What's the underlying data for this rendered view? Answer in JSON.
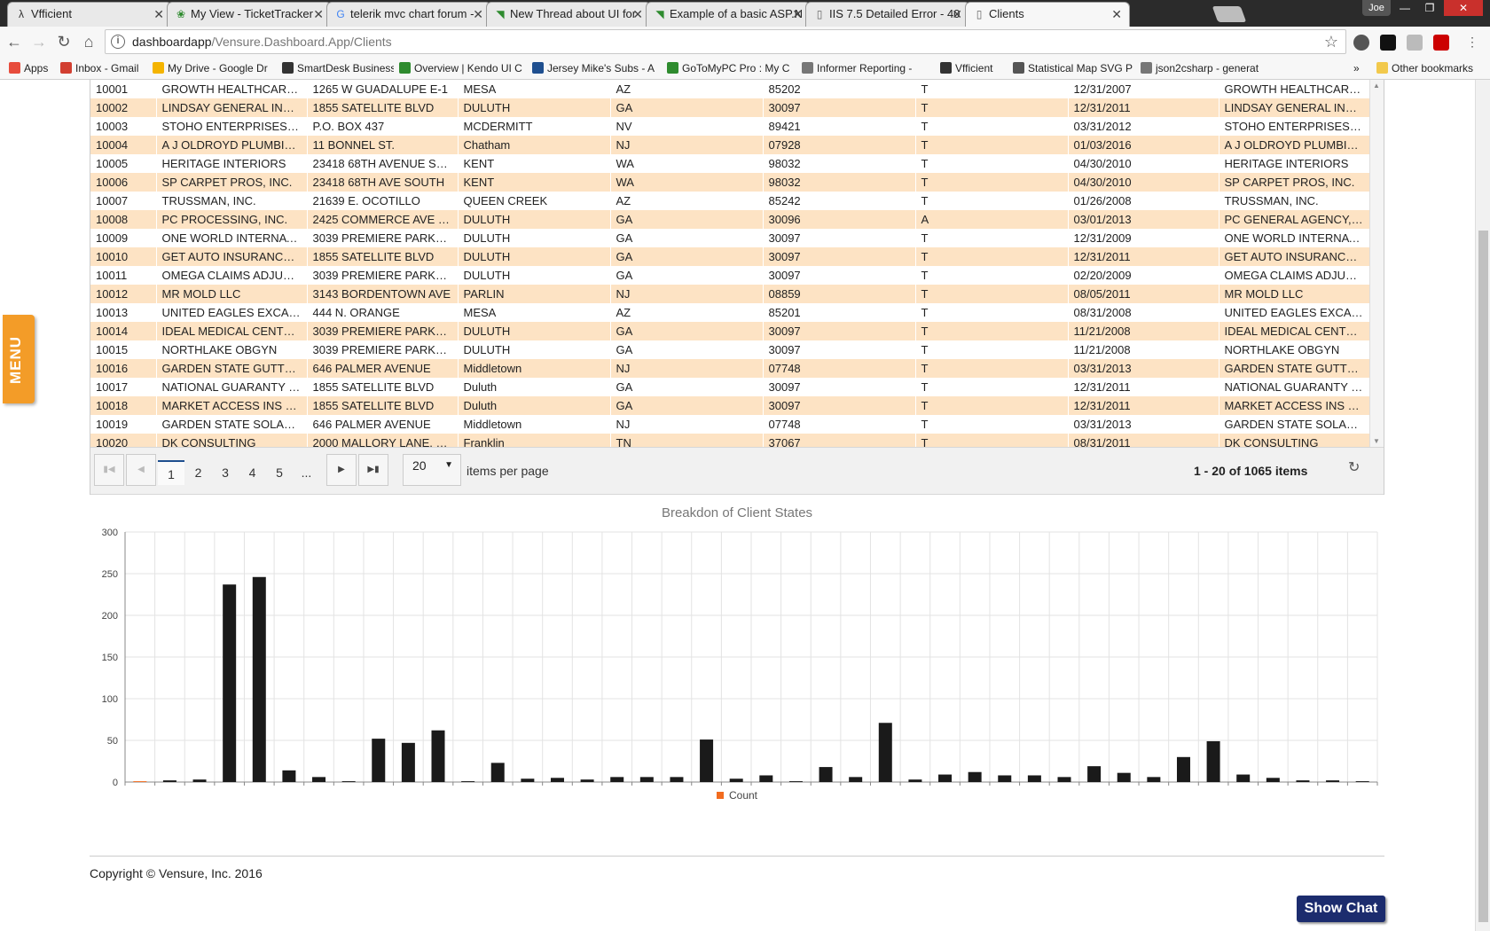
{
  "browser": {
    "tabs": [
      {
        "title": "Vfficient",
        "icon": "vfficient-icon"
      },
      {
        "title": "My View - TicketTracker",
        "icon": "tickettracker-icon"
      },
      {
        "title": "telerik mvc chart forum -",
        "icon": "google-icon"
      },
      {
        "title": "New Thread about UI for",
        "icon": "telerik-icon"
      },
      {
        "title": "Example of a basic ASP.N",
        "icon": "telerik-icon"
      },
      {
        "title": "IIS 7.5 Detailed Error - 40",
        "icon": "page-icon"
      },
      {
        "title": "Clients",
        "icon": "page-icon"
      }
    ],
    "profile_name": "Joe",
    "url_host": "dashboardapp",
    "url_path": "/Vensure.Dashboard.App/Clients",
    "bookmarks": [
      "Apps",
      "Inbox - Gmail",
      "My Drive - Google Dr",
      "SmartDesk Business C",
      "Overview | Kendo UI C",
      "Jersey Mike's Subs - A",
      "GoToMyPC Pro : My C",
      "Informer Reporting -",
      "Vfficient",
      "Statistical Map SVG P",
      "json2csharp - generat"
    ],
    "other_bookmarks": "Other bookmarks"
  },
  "side_menu_label": "MENU",
  "grid": {
    "rows": [
      [
        "10001",
        "GROWTH HEALTHCARE…",
        "1265 W GUADALUPE E-1",
        "MESA",
        "AZ",
        "85202",
        "T",
        "12/31/2007",
        "GROWTH HEALTHCARE…"
      ],
      [
        "10002",
        "LINDSAY GENERAL INS…",
        "1855 SATELLITE BLVD",
        "DULUTH",
        "GA",
        "30097",
        "T",
        "12/31/2011",
        "LINDSAY GENERAL INS…"
      ],
      [
        "10003",
        "STOHO ENTERPRISES,…",
        "P.O. BOX 437",
        "MCDERMITT",
        "NV",
        "89421",
        "T",
        "03/31/2012",
        "STOHO ENTERPRISES, …"
      ],
      [
        "10004",
        "A J OLDROYD PLUMBIN…",
        "11 BONNEL ST.",
        "Chatham",
        "NJ",
        "07928",
        "T",
        "01/03/2016",
        "A J OLDROYD PLUMBIN…"
      ],
      [
        "10005",
        "HERITAGE INTERIORS",
        "23418 68TH AVENUE S…",
        "KENT",
        "WA",
        "98032",
        "T",
        "04/30/2010",
        "HERITAGE INTERIORS"
      ],
      [
        "10006",
        "SP CARPET PROS, INC.",
        "23418 68TH AVE SOUTH",
        "KENT",
        "WA",
        "98032",
        "T",
        "04/30/2010",
        "SP CARPET PROS, INC."
      ],
      [
        "10007",
        "TRUSSMAN, INC.",
        "21639 E. OCOTILLO",
        "QUEEN CREEK",
        "AZ",
        "85242",
        "T",
        "01/26/2008",
        "TRUSSMAN, INC."
      ],
      [
        "10008",
        "PC PROCESSING, INC.",
        "2425 COMMERCE AVE …",
        "DULUTH",
        "GA",
        "30096",
        "A",
        "03/01/2013",
        "PC GENERAL AGENCY, …"
      ],
      [
        "10009",
        "ONE WORLD INTERNAT…",
        "3039 PREMIERE PARK…",
        "DULUTH",
        "GA",
        "30097",
        "T",
        "12/31/2009",
        "ONE WORLD INTERNAT…"
      ],
      [
        "10010",
        "GET AUTO INSURANCE…",
        "1855 SATELLITE BLVD",
        "DULUTH",
        "GA",
        "30097",
        "T",
        "12/31/2011",
        "GET AUTO INSURANCE …"
      ],
      [
        "10011",
        "OMEGA CLAIMS ADJUS…",
        "3039 PREMIERE PARK…",
        "DULUTH",
        "GA",
        "30097",
        "T",
        "02/20/2009",
        "OMEGA CLAIMS ADJUS…"
      ],
      [
        "10012",
        "MR MOLD LLC",
        "3143 BORDENTOWN AVE",
        "PARLIN",
        "NJ",
        "08859",
        "T",
        "08/05/2011",
        "MR MOLD LLC"
      ],
      [
        "10013",
        "UNITED EAGLES EXCA…",
        "444 N. ORANGE",
        "MESA",
        "AZ",
        "85201",
        "T",
        "08/31/2008",
        "UNITED EAGLES EXCA…"
      ],
      [
        "10014",
        "IDEAL MEDICAL CENTE…",
        "3039 PREMIERE PARK…",
        "DULUTH",
        "GA",
        "30097",
        "T",
        "11/21/2008",
        "IDEAL MEDICAL CENTE…"
      ],
      [
        "10015",
        "NORTHLAKE OBGYN",
        "3039 PREMIERE PARK…",
        "DULUTH",
        "GA",
        "30097",
        "T",
        "11/21/2008",
        "NORTHLAKE OBGYN"
      ],
      [
        "10016",
        "GARDEN STATE GUTTE…",
        "646 PALMER AVENUE",
        "Middletown",
        "NJ",
        "07748",
        "T",
        "03/31/2013",
        "GARDEN STATE GUTTE…"
      ],
      [
        "10017",
        "NATIONAL GUARANTY I…",
        "1855 SATELLITE BLVD",
        "Duluth",
        "GA",
        "30097",
        "T",
        "12/31/2011",
        "NATIONAL GUARANTY I…"
      ],
      [
        "10018",
        "MARKET ACCESS INS …",
        "1855 SATELLITE BLVD",
        "Duluth",
        "GA",
        "30097",
        "T",
        "12/31/2011",
        "MARKET ACCESS INS …"
      ],
      [
        "10019",
        "GARDEN STATE SOLAR…",
        "646 PALMER AVENUE",
        "Middletown",
        "NJ",
        "07748",
        "T",
        "03/31/2013",
        "GARDEN STATE SOLAR…"
      ],
      [
        "10020",
        "DK CONSULTING",
        "2000 MALLORY LANE, S…",
        "Franklin",
        "TN",
        "37067",
        "T",
        "08/31/2011",
        "DK CONSULTING"
      ]
    ]
  },
  "pager": {
    "pages": [
      "1",
      "2",
      "3",
      "4",
      "5",
      "..."
    ],
    "current_page": "1",
    "page_size": "20",
    "items_per_page_label": "items per page",
    "info": "1 - 20 of 1065 items"
  },
  "chart_data": {
    "type": "bar",
    "title": "Breakdon of Client States",
    "xlabel": "",
    "ylabel": "",
    "ylim": [
      0,
      300
    ],
    "yticks": [
      0,
      50,
      100,
      150,
      200,
      250,
      300
    ],
    "grid": true,
    "legend_position": "bottom",
    "series": [
      {
        "name": "Count",
        "color": "#f26c1f",
        "values": [
          1,
          2,
          3,
          237,
          246,
          14,
          6,
          1,
          52,
          47,
          62,
          1,
          23,
          4,
          5,
          3,
          6,
          6,
          6,
          51,
          4,
          8,
          1,
          18,
          6,
          71,
          3,
          9,
          12,
          8,
          8,
          6,
          19,
          11,
          6,
          30,
          49,
          9,
          5,
          2,
          2,
          1
        ]
      }
    ],
    "bar_color": "#1a1a1a"
  },
  "footer": {
    "copyright": "Copyright © Vensure, Inc. 2016"
  },
  "chat_button": "Show Chat"
}
